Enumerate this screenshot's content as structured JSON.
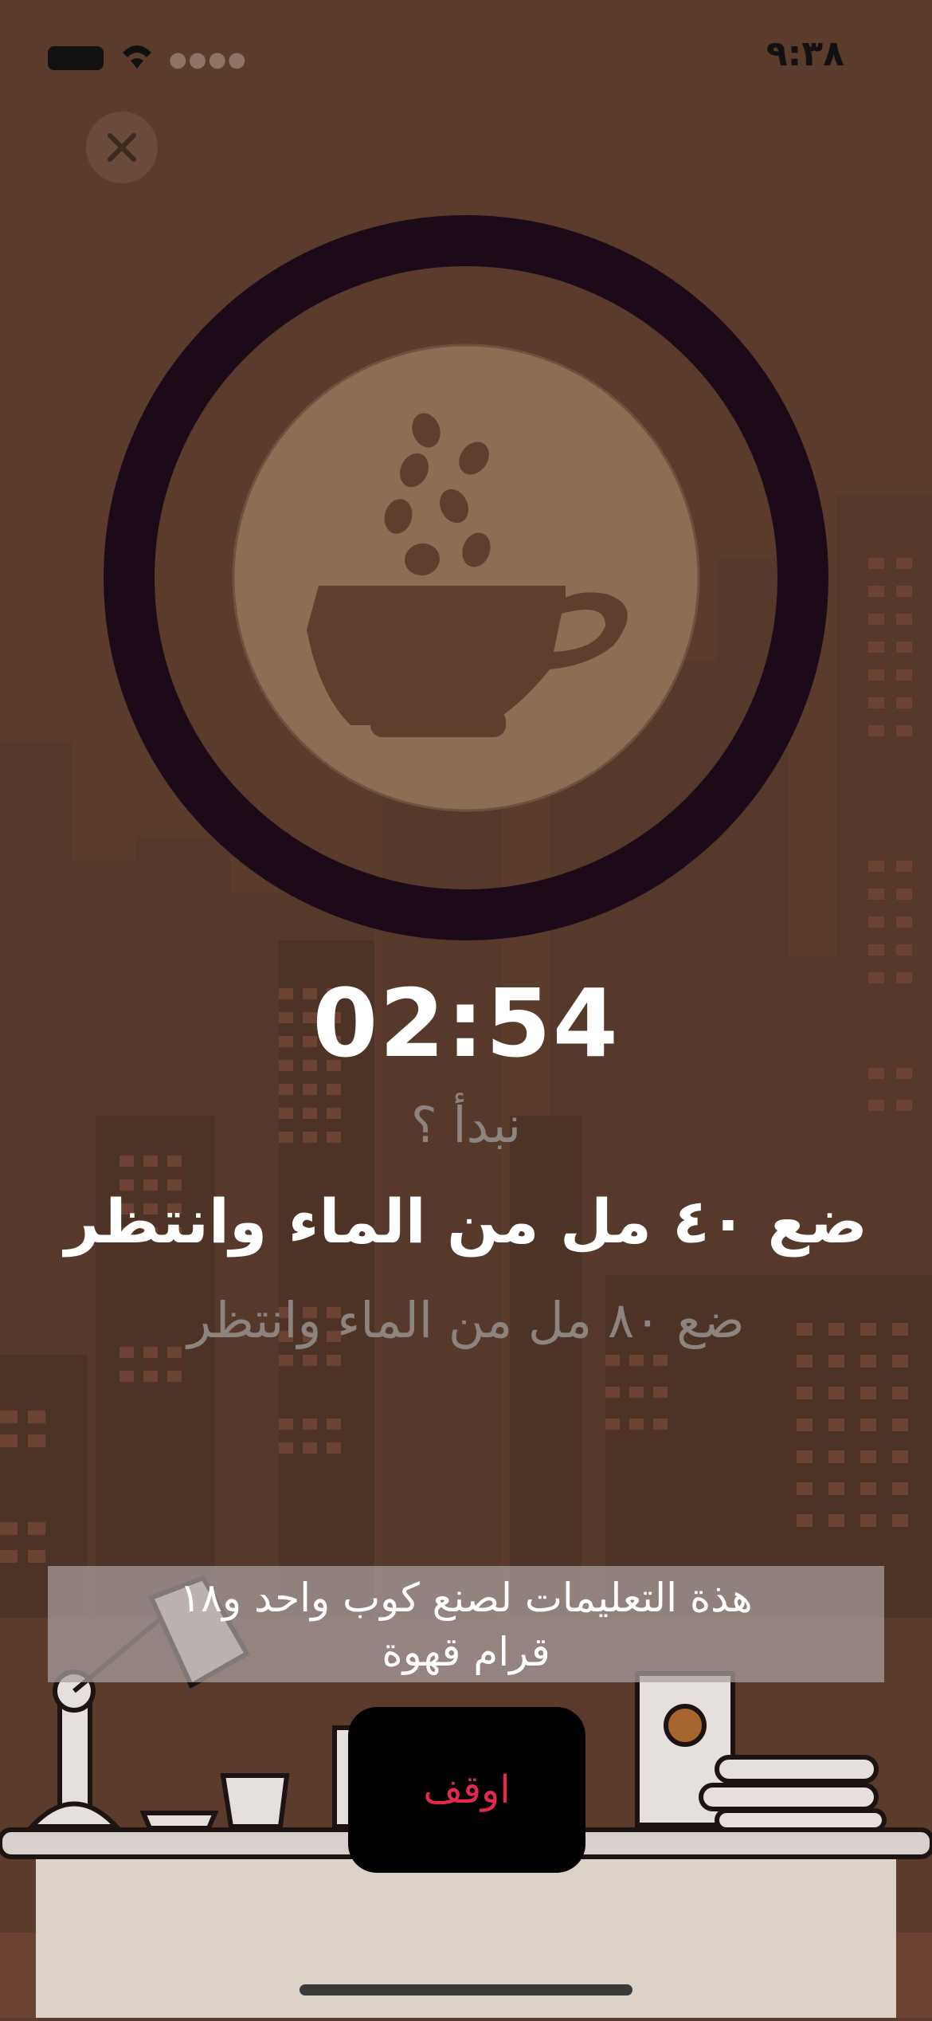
{
  "status_bar": {
    "time": "٩:٣٨"
  },
  "timer": {
    "display": "02:54"
  },
  "steps": {
    "previous": "نبدأ ؟",
    "current": "ضع ٤٠ مل من الماء وانتظر",
    "next": "ضع ٨٠ مل من الماء وانتظر"
  },
  "info_banner": {
    "line1": "هذة التعليمات لصنع كوب واحد و١٨",
    "line2": "قرام قهوة"
  },
  "stop_button": {
    "label": "اوقف"
  },
  "colors": {
    "background": "#5b3b2c",
    "ring": "#1c0a18",
    "cup_disc": "#8d6d53",
    "stop_text": "#e02a4e"
  },
  "icons": [
    "battery-icon",
    "wifi-icon",
    "close-icon",
    "coffee-cup-icon",
    "coffee-bean-icon"
  ]
}
